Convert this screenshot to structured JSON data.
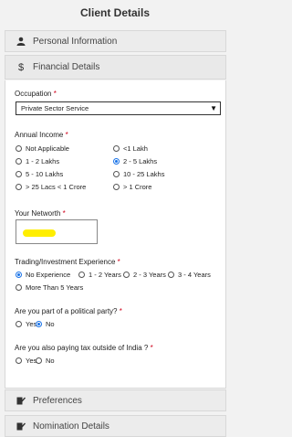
{
  "page": {
    "title": "Client Details"
  },
  "sections": {
    "personal": "Personal Information",
    "financial": "Financial Details",
    "preferences": "Preferences",
    "nomination": "Nomination Details"
  },
  "form": {
    "occupation": {
      "label": "Occupation",
      "value": "Private Sector Service"
    },
    "income": {
      "label": "Annual Income",
      "options": [
        "Not Applicable",
        "<1 Lakh",
        "1 - 2 Lakhs",
        "2 - 5 Lakhs",
        "5 - 10 Lakhs",
        "10 - 25 Lakhs",
        "> 25 Lacs < 1 Crore",
        "> 1 Crore"
      ],
      "selected": "2 - 5 Lakhs"
    },
    "networth": {
      "label": "Your Networth"
    },
    "experience": {
      "label": "Trading/Investment Experience",
      "options": [
        "No Experience",
        "1 - 2 Years",
        "2 - 3 Years",
        "3 - 4 Years",
        "More Than 5 Years"
      ],
      "selected": "No Experience"
    },
    "political": {
      "label": "Are you part of a political party?",
      "options": [
        "Yes",
        "No"
      ],
      "selected": "No"
    },
    "tax": {
      "label": "Are you also paying tax outside of India ?",
      "options": [
        "Yes",
        "No"
      ],
      "selected": ""
    },
    "required_mark": "*"
  },
  "icons": {
    "personal": "user-icon",
    "financial": "dollar-icon",
    "preferences": "edit-icon",
    "nomination": "edit-icon",
    "dropdown": "triangle-down-icon"
  }
}
